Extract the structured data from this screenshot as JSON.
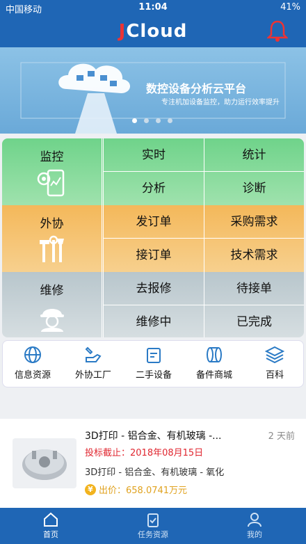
{
  "status": {
    "carrier": "中国移动",
    "time": "11:04",
    "battery": "41%"
  },
  "app": {
    "logo_j": "J",
    "logo_rest": "Cloud"
  },
  "banner": {
    "title": "数控设备分析云平台",
    "subtitle": "专注机加设备监控，助力运行效率提升",
    "active_dot": 0
  },
  "grid": {
    "monitor": {
      "label": "监控",
      "items": [
        "实时",
        "统计",
        "分析",
        "诊断"
      ]
    },
    "outsource": {
      "label": "外协",
      "items": [
        "发订单",
        "采购需求",
        "接订单",
        "技术需求"
      ]
    },
    "repair": {
      "label": "维修",
      "items": [
        "去报修",
        "待接单",
        "维修中",
        "已完成"
      ]
    }
  },
  "quick": [
    "信息资源",
    "外协工厂",
    "二手设备",
    "备件商城",
    "百科"
  ],
  "card": {
    "title": "3D打印 - 铝合金、有机玻璃 -...",
    "ago": "2 天前",
    "deadline": "投标截止：2018年08月15日",
    "desc": "3D打印 - 铝合金、有机玻璃 - 氧化",
    "price": "出价：658.0741万元",
    "coin": "¥"
  },
  "tabs": [
    "首页",
    "任务资源",
    "我的"
  ],
  "colors": {
    "primary": "#1f66b5",
    "accent_red": "#e0262f",
    "gold": "#e0a21f"
  }
}
